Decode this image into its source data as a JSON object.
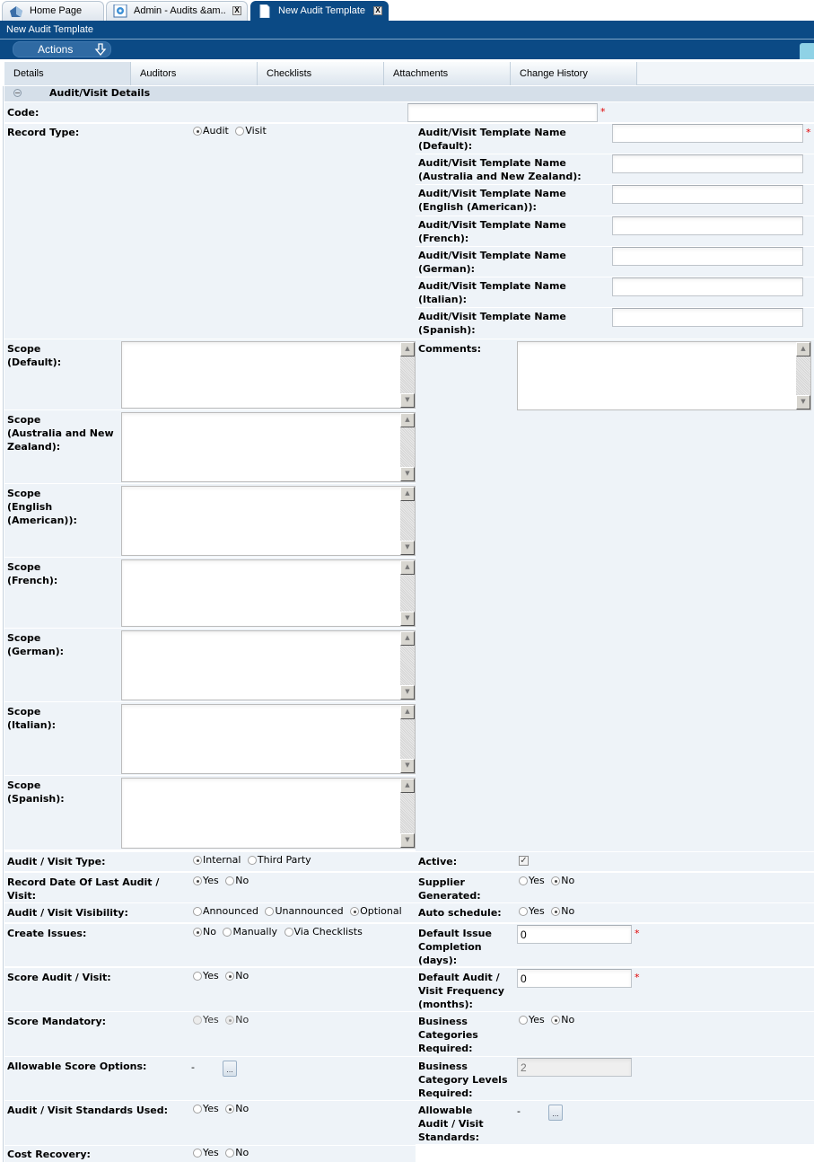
{
  "browser_tabs": [
    {
      "label": "Home Page",
      "icon": "home-icon",
      "closable": false,
      "active": false
    },
    {
      "label": "Admin - Audits &am..",
      "icon": "gear-icon",
      "closable": true,
      "active": false
    },
    {
      "label": "New Audit Template",
      "icon": "document-icon",
      "closable": true,
      "active": true
    }
  ],
  "close_glyph": "X",
  "page_title": "New Audit Template",
  "toolbar": {
    "actions_label": "Actions"
  },
  "section_tabs": [
    "Details",
    "Auditors",
    "Checklists",
    "Attachments",
    "Change History"
  ],
  "section": {
    "title": "Audit/Visit Details",
    "collapse_glyph": "−"
  },
  "required_mark": "*",
  "colors": {
    "header": "#0b4a85",
    "panel": "#eef3f8",
    "required": "#e00000"
  },
  "fields": {
    "code": {
      "label": "Code:",
      "value": ""
    },
    "record_type": {
      "label": "Record Type:",
      "options": [
        "Audit",
        "Visit"
      ],
      "selected": "Audit"
    },
    "template_names": [
      {
        "label1": "Audit/Visit Template Name",
        "label2": "(Default):",
        "value": "",
        "required": true
      },
      {
        "label1": "Audit/Visit Template Name",
        "label2": "(Australia and New Zealand):",
        "value": ""
      },
      {
        "label1": "Audit/Visit Template Name",
        "label2": "(English (American)):",
        "value": ""
      },
      {
        "label1": "Audit/Visit Template Name",
        "label2": "(French):",
        "value": ""
      },
      {
        "label1": "Audit/Visit Template Name",
        "label2": "(German):",
        "value": ""
      },
      {
        "label1": "Audit/Visit Template Name",
        "label2": "(Italian):",
        "value": ""
      },
      {
        "label1": "Audit/Visit Template Name",
        "label2": "(Spanish):",
        "value": ""
      }
    ],
    "scopes": [
      {
        "lines": [
          "Scope",
          "(Default):"
        ],
        "value": ""
      },
      {
        "lines": [
          "Scope",
          "(Australia and New",
          "Zealand):"
        ],
        "value": ""
      },
      {
        "lines": [
          "Scope",
          "(English",
          "(American)):"
        ],
        "value": ""
      },
      {
        "lines": [
          "Scope",
          "(French):"
        ],
        "value": ""
      },
      {
        "lines": [
          "Scope",
          "(German):"
        ],
        "value": ""
      },
      {
        "lines": [
          "Scope",
          "(Italian):"
        ],
        "value": ""
      },
      {
        "lines": [
          "Scope",
          "(Spanish):"
        ],
        "value": ""
      }
    ],
    "comments": {
      "label": "Comments:",
      "value": ""
    },
    "audit_visit_type": {
      "label": "Audit / Visit Type:",
      "options": [
        "Internal",
        "Third Party"
      ],
      "selected": "Internal"
    },
    "record_date_last": {
      "label1": "Record Date Of Last Audit /",
      "label2": "Visit:",
      "options": [
        "Yes",
        "No"
      ],
      "selected": "Yes"
    },
    "visibility": {
      "label": "Audit / Visit Visibility:",
      "options": [
        "Announced",
        "Unannounced",
        "Optional"
      ],
      "selected": "Optional"
    },
    "create_issues": {
      "label": "Create Issues:",
      "options": [
        "No",
        "Manually",
        "Via Checklists"
      ],
      "selected": "No"
    },
    "score_audit": {
      "label": "Score Audit / Visit:",
      "options": [
        "Yes",
        "No"
      ],
      "selected": "No"
    },
    "score_mandatory": {
      "label": "Score Mandatory:",
      "options": [
        "Yes",
        "No"
      ],
      "selected": "No",
      "disabled": true
    },
    "allowable_score_options": {
      "label": "Allowable Score Options:",
      "value": "-",
      "button": "..."
    },
    "standards_used": {
      "label": "Audit / Visit Standards Used:",
      "options": [
        "Yes",
        "No"
      ],
      "selected": "No"
    },
    "cost_recovery": {
      "label": "Cost Recovery:",
      "options": [
        "Yes",
        "No"
      ],
      "selected": null
    },
    "active": {
      "label": "Active:",
      "checked": true,
      "check_glyph": "✓"
    },
    "supplier_generated": {
      "label1": "Supplier",
      "label2": "Generated:",
      "options": [
        "Yes",
        "No"
      ],
      "selected": "No"
    },
    "auto_schedule": {
      "label": "Auto schedule:",
      "options": [
        "Yes",
        "No"
      ],
      "selected": "No"
    },
    "default_issue_completion": {
      "lines": [
        "Default Issue",
        "Completion",
        "(days):"
      ],
      "value": "0"
    },
    "default_frequency": {
      "lines": [
        "Default Audit /",
        "Visit Frequency",
        "(months):"
      ],
      "value": "0"
    },
    "business_categories_required": {
      "lines": [
        "Business",
        "Categories",
        "Required:"
      ],
      "options": [
        "Yes",
        "No"
      ],
      "selected": "No"
    },
    "business_category_levels": {
      "lines": [
        "Business",
        "Category Levels",
        "Required:"
      ],
      "value": "2"
    },
    "allowable_standards": {
      "lines": [
        "Allowable",
        "Audit / Visit",
        "Standards:"
      ],
      "value": "-",
      "button": "..."
    }
  }
}
